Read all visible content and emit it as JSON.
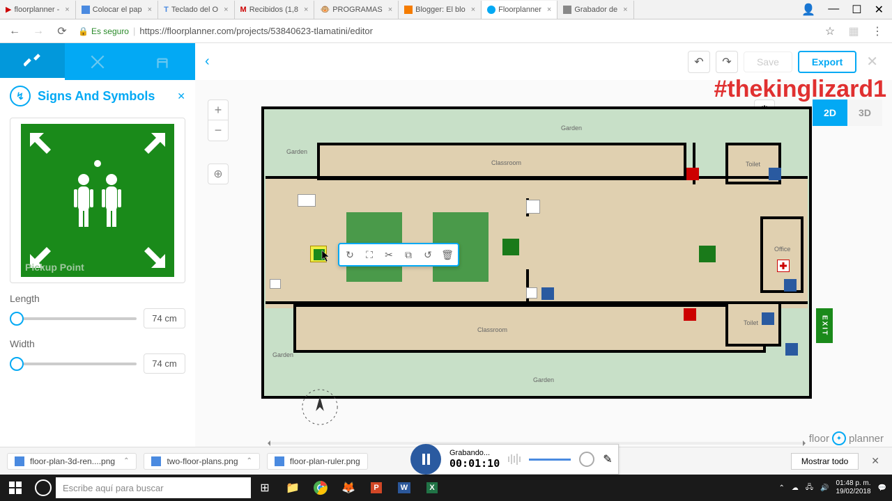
{
  "browser": {
    "tabs": [
      {
        "label": "floorplanner -"
      },
      {
        "label": "Colocar el pap"
      },
      {
        "label": "Teclado del O"
      },
      {
        "label": "Recibidos (1,8"
      },
      {
        "label": "PROGRAMAS"
      },
      {
        "label": "Blogger: El blo"
      },
      {
        "label": "Floorplanner",
        "active": true
      },
      {
        "label": "Grabador de"
      }
    ],
    "secure": "Es seguro",
    "url": "https://floorplanner.com/projects/53840623-tlamatini/editor"
  },
  "topbar": {
    "save": "Save",
    "export": "Export"
  },
  "sidebar": {
    "title": "Signs And Symbols",
    "icon_label": "↯",
    "preview_caption": "Pickup Point",
    "length_label": "Length",
    "length_value": "74 cm",
    "width_label": "Width",
    "width_value": "74 cm"
  },
  "view": {
    "d2": "2D",
    "d3": "3D"
  },
  "plan": {
    "garden1": "Garden",
    "garden2": "Garden",
    "garden3": "Garden",
    "classroom1": "Classroom",
    "classroom2": "Classroom",
    "toilet1": "Toilet",
    "toilet2": "Toilet",
    "office": "Office",
    "exit": "EXIT"
  },
  "watermark": "#thekinglizard1",
  "logo": {
    "a": "floor",
    "b": "planner"
  },
  "downloads": {
    "f1": "floor-plan-3d-ren....png",
    "f2": "two-floor-plans.png",
    "f3": "floor-plan-ruler.png",
    "show": "Mostrar todo"
  },
  "recorder": {
    "status": "Grabando...",
    "time": "00:01:10"
  },
  "taskbar": {
    "search": "Escribe aquí para buscar",
    "time": "01:48 p. m.",
    "date": "19/02/2018"
  }
}
